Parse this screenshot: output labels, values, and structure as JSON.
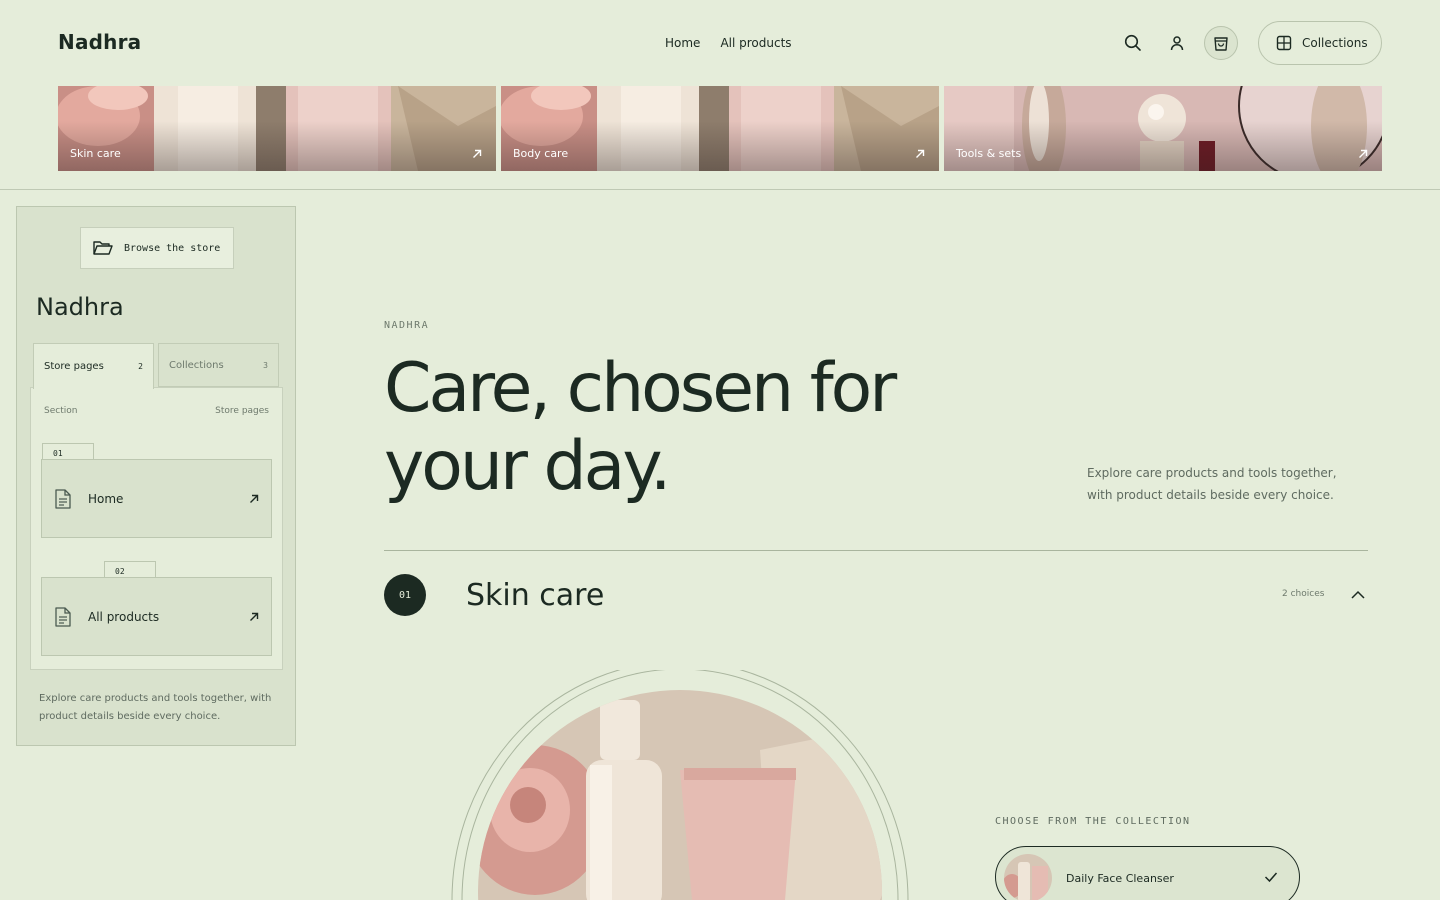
{
  "header": {
    "brand": "Nadhra",
    "nav": [
      "Home",
      "All products"
    ],
    "collections_label": "Collections"
  },
  "categories": [
    {
      "label": "Skin care",
      "icon": "arrow-up-right-icon"
    },
    {
      "label": "Body care",
      "icon": "arrow-up-right-icon"
    },
    {
      "label": "Tools & sets",
      "icon": "arrow-up-right-icon"
    }
  ],
  "sidebar": {
    "browse_label": "Browse the store",
    "title": "Nadhra",
    "tabs": [
      {
        "label": "Store pages",
        "count": "2"
      },
      {
        "label": "Collections",
        "count": "3"
      }
    ],
    "panel_head_left": "Section",
    "panel_head_right": "Store pages",
    "pages": [
      {
        "num": "01",
        "label": "Home"
      },
      {
        "num": "02",
        "label": "All products"
      }
    ],
    "footer": "Explore care products and tools together, with product details beside every choice."
  },
  "hero": {
    "eyebrow": "NADHRA",
    "title": "Care, chosen for your day.",
    "description": "Explore care products and tools together, with product details beside every choice."
  },
  "section": {
    "num": "01",
    "title": "Skin care",
    "choices": "2 choices"
  },
  "collection": {
    "label": "CHOOSE FROM THE COLLECTION",
    "selected": "Daily Face Cleanser"
  },
  "colors": {
    "background": "#e5edda",
    "ink": "#1c2a22",
    "panel": "#d9e2cd",
    "muted": "#6e7a6d"
  }
}
